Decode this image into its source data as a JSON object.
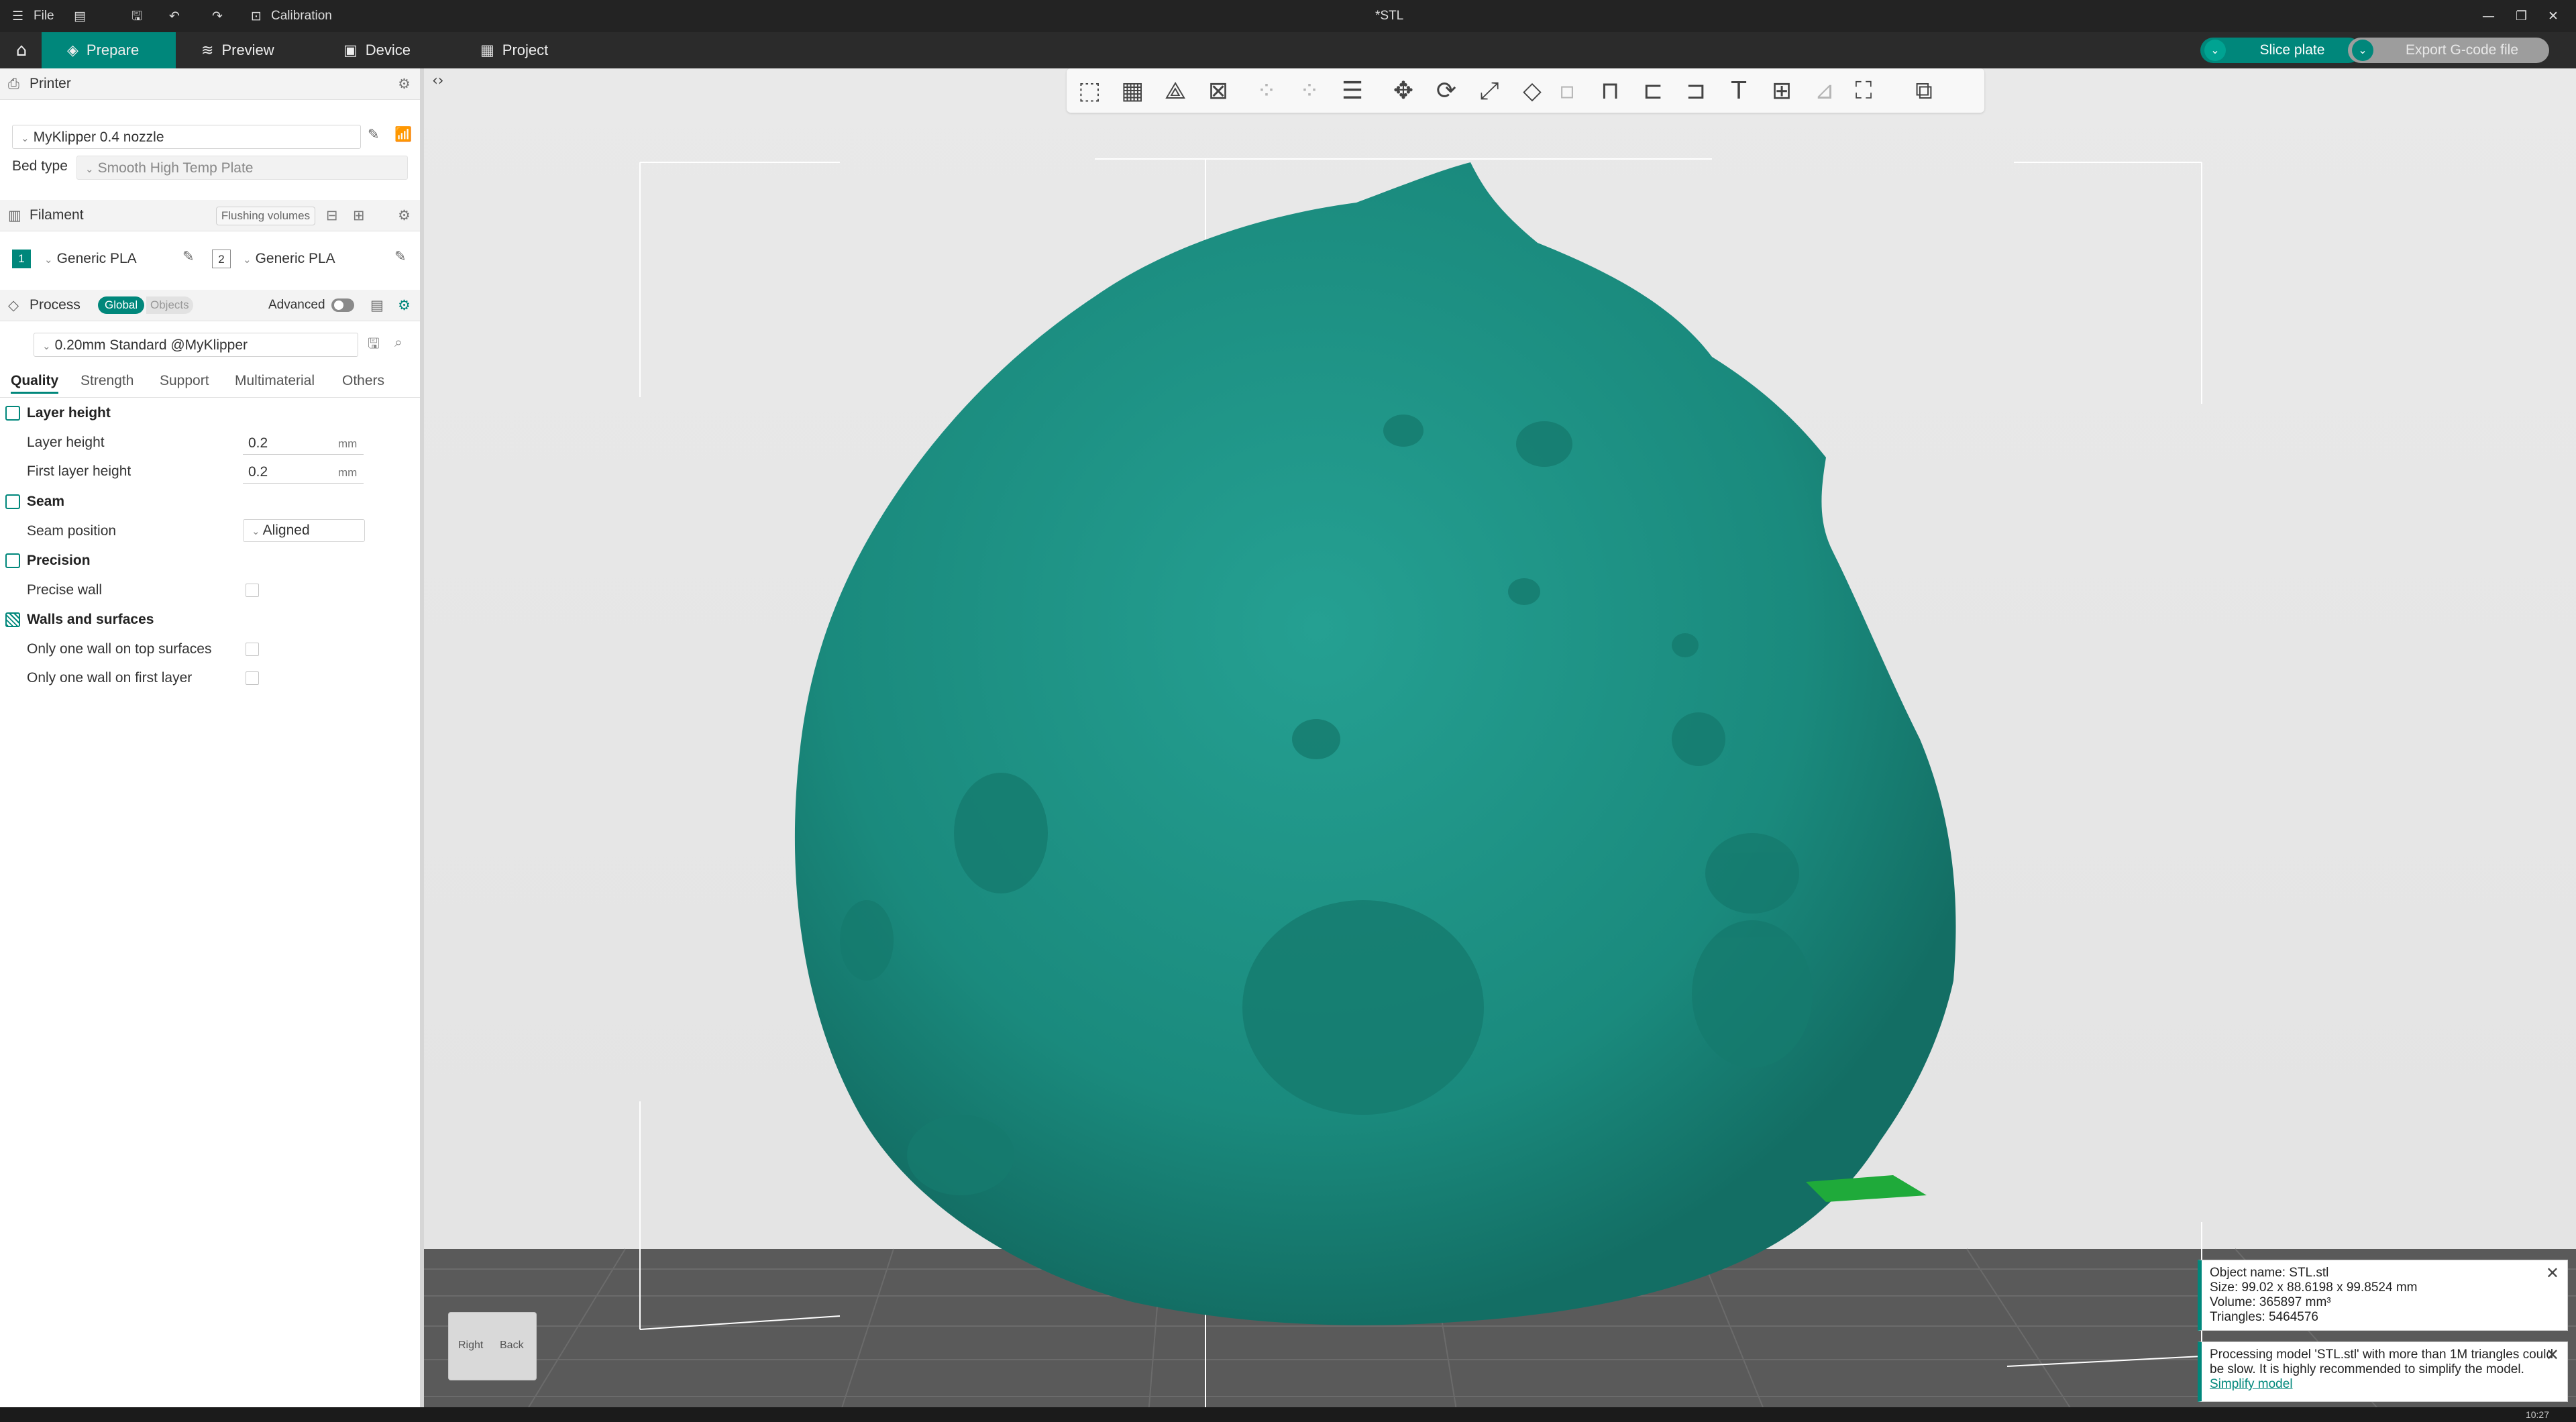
{
  "titlebar": {
    "file_label": "File",
    "calibration_label": "Calibration",
    "document_title": "*STL"
  },
  "tabs": [
    {
      "label": "Prepare"
    },
    {
      "label": "Preview"
    },
    {
      "label": "Device"
    },
    {
      "label": "Project"
    }
  ],
  "actions": {
    "slice_label": "Slice plate",
    "export_label": "Export G-code file"
  },
  "printer": {
    "section_label": "Printer",
    "selected": "MyKlipper 0.4 nozzle",
    "bed_type_label": "Bed type",
    "bed_type_value": "Smooth High Temp Plate"
  },
  "filament": {
    "section_label": "Filament",
    "flushing_label": "Flushing volumes",
    "slots": [
      {
        "number": "1",
        "name": "Generic PLA",
        "color": "#00877b"
      },
      {
        "number": "2",
        "name": "Generic PLA",
        "color": "#ffffff"
      }
    ]
  },
  "process": {
    "section_label": "Process",
    "global_label": "Global",
    "objects_label": "Objects",
    "advanced_label": "Advanced",
    "preset": "0.20mm Standard @MyKlipper",
    "tabs": [
      "Quality",
      "Strength",
      "Support",
      "Multimaterial",
      "Others"
    ],
    "groups": {
      "layer_height": {
        "title": "Layer height",
        "layer_height_label": "Layer height",
        "layer_height_value": "0.2",
        "first_layer_label": "First layer height",
        "first_layer_value": "0.2",
        "unit": "mm"
      },
      "seam": {
        "title": "Seam",
        "position_label": "Seam position",
        "position_value": "Aligned"
      },
      "precision": {
        "title": "Precision",
        "precise_wall_label": "Precise wall"
      },
      "walls": {
        "title": "Walls and surfaces",
        "one_wall_top_label": "Only one wall on top surfaces",
        "one_wall_first_label": "Only one wall on first layer"
      }
    }
  },
  "view_cube": {
    "right_label": "Right",
    "back_label": "Back"
  },
  "object_info": {
    "name": "Object name: STL.stl",
    "size": "Size: 99.02 x 88.6198 x 99.8524 mm",
    "volume": "Volume: 365897 mm³",
    "triangles": "Triangles: 5464576"
  },
  "warning": {
    "text": "Processing model 'STL.stl' with more than 1M triangles could be slow. It is highly recommended to simplify the model.",
    "link": "Simplify model"
  },
  "clock": "10:27",
  "colors": {
    "accent": "#00877b",
    "model": "#1e9485",
    "titlebar": "#232323"
  }
}
